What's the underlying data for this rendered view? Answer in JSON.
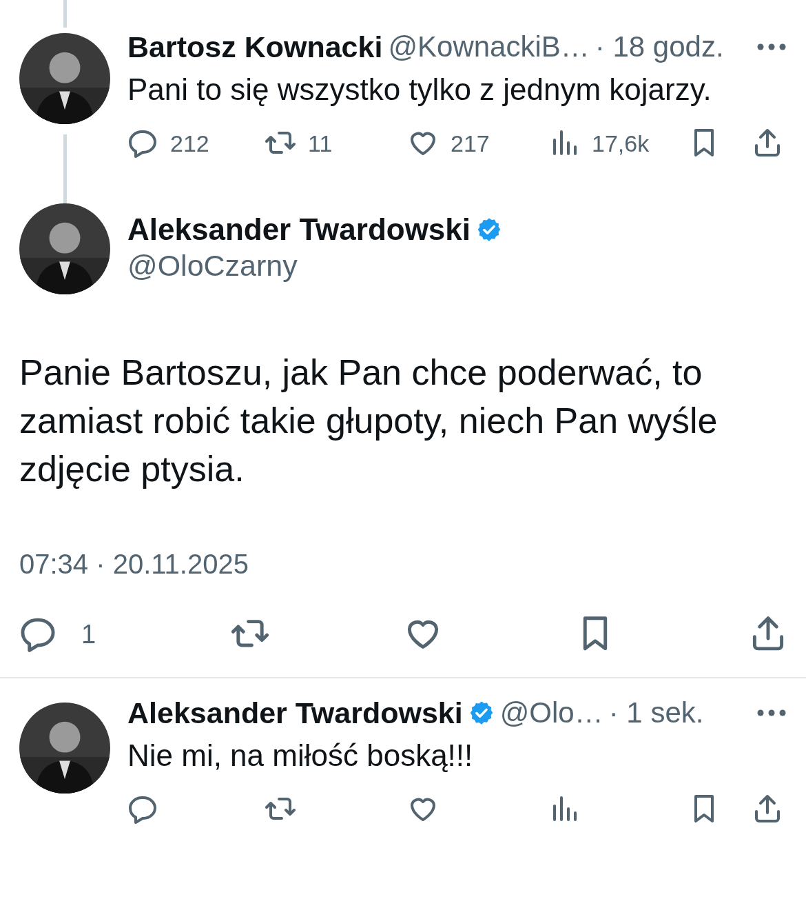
{
  "tweets": [
    {
      "kind": "compact",
      "thread_above": true,
      "thread_below": true,
      "avatar": {
        "kind": "picture"
      },
      "name": "Bartosz Kownacki",
      "verified": false,
      "handle": "@KownackiB…",
      "time": "· 18 godz.",
      "text": "Pani to się wszystko tylko z jednym kojarzy.",
      "actions": [
        {
          "kind": "reply",
          "count": "212"
        },
        {
          "kind": "repost",
          "count": "11"
        },
        {
          "kind": "like",
          "count": "217"
        },
        {
          "kind": "views",
          "count": "17,6k"
        },
        {
          "kind": "bookmark"
        },
        {
          "kind": "share"
        }
      ]
    },
    {
      "kind": "focused",
      "thread_above": false,
      "thread_below": false,
      "avatar": {
        "kind": "picture"
      },
      "name": "Aleksander Twardowski",
      "verified": true,
      "handle": "@OloCzarny",
      "text": "Panie Bartoszu, jak Pan chce poderwać, to zamiast robić takie głupoty, niech Pan wyśle zdjęcie ptysia.",
      "time": "07:34 · 20.11.2025",
      "actions": [
        {
          "kind": "reply",
          "count": "1"
        },
        {
          "kind": "repost"
        },
        {
          "kind": "like"
        },
        {
          "kind": "bookmark"
        },
        {
          "kind": "share"
        }
      ]
    },
    {
      "kind": "compact",
      "thread_above": false,
      "thread_below": false,
      "avatar": {
        "kind": "picture"
      },
      "name": "Aleksander Twardowski",
      "verified": true,
      "handle": "@Olo…",
      "time": "· 1 sek.",
      "text": "Nie mi, na miłość boską!!!",
      "actions": [
        {
          "kind": "reply"
        },
        {
          "kind": "repost"
        },
        {
          "kind": "like"
        },
        {
          "kind": "views"
        },
        {
          "kind": "bookmark"
        },
        {
          "kind": "share"
        }
      ]
    }
  ]
}
